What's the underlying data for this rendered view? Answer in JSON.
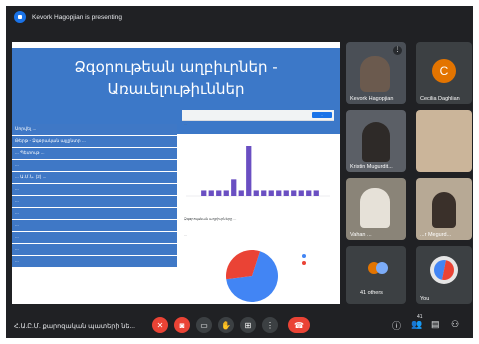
{
  "presenting_bar": {
    "text": "Kevork Hagopjian is presenting"
  },
  "slide": {
    "title_line1": "Ձգօրութեան աղբիւրներ -",
    "title_line2": "Առաւելութիւններ",
    "list_items": [
      "Սորվել ... ",
      "Թերթ - Ձգօրական այլընտր ... ",
      "... Պետութ ...",
      "... ",
      "... Ա.Մ.Ն. (2) ...",
      "... ",
      "... ",
      "... ",
      "... ",
      "... ",
      "... ",
      "... "
    ],
    "chart_button": "...",
    "chart_caption": "...",
    "chart_question": "Ձգօրութեան աղբիւրները ...",
    "chart_subcaption": "...",
    "pie_label_red": "...",
    "pie_label_blue": "...",
    "colors": {
      "bar": "#6a4fc2",
      "pie_red": "#ea4335",
      "pie_blue": "#4285f4",
      "banner": "#3c78c8"
    }
  },
  "chart_data": {
    "type": "bar",
    "values": [
      1,
      1,
      1,
      1,
      3,
      1,
      9,
      1,
      1,
      1,
      1,
      1,
      1,
      1,
      1,
      1
    ]
  },
  "pie_data": {
    "type": "pie",
    "values": [
      68,
      32
    ]
  },
  "participants": [
    {
      "name": "Kevork Hagopjian",
      "kind": "video"
    },
    {
      "name": "Cecilia Daghlian",
      "kind": "avatar",
      "initial": "C",
      "color": "#e37400"
    },
    {
      "name": "Kristin Mugurdit...",
      "kind": "video"
    },
    {
      "name": "",
      "kind": "video"
    },
    {
      "name": "Vahan ...",
      "kind": "video"
    },
    {
      "name": "...r Megurd...",
      "kind": "video"
    },
    {
      "name": "41 others",
      "kind": "others"
    },
    {
      "name": "You",
      "kind": "self"
    }
  ],
  "bottom_bar": {
    "meeting_name": "Հ.Ա.Ը.Մ. քարոզական պատերի նե...",
    "participants_count": "41"
  },
  "icons": [
    "presenting-icon",
    "mic-off-icon",
    "camera-off-icon",
    "captions-icon",
    "raise-hand-icon",
    "present-icon",
    "more-options-icon",
    "end-call-icon",
    "info-icon",
    "people-icon",
    "chat-icon",
    "activities-icon"
  ]
}
